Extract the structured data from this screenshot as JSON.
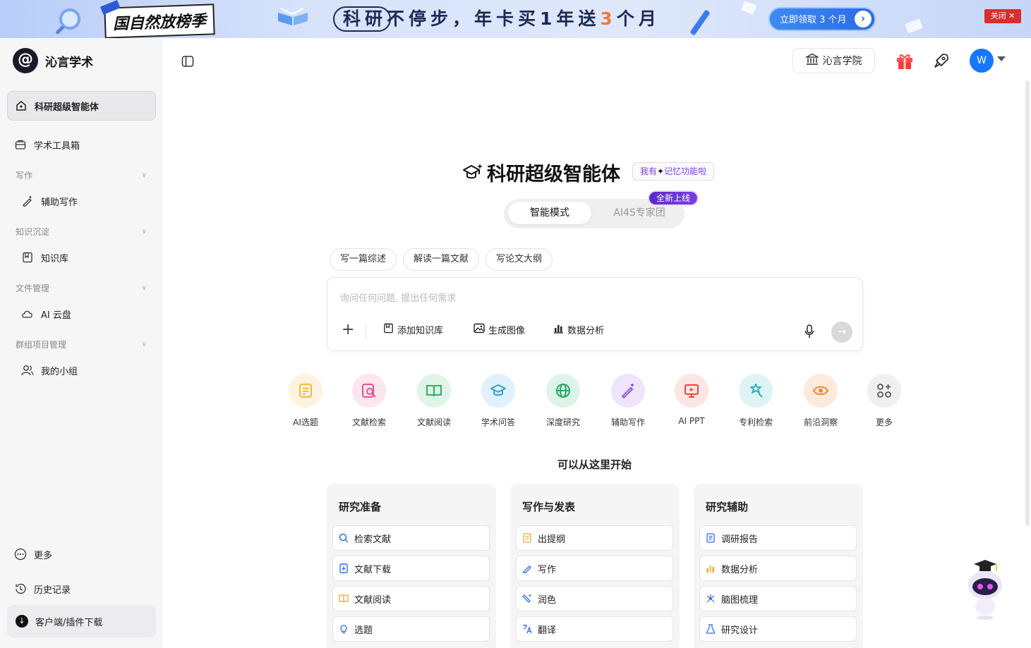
{
  "banner": {
    "tag": "国自然放榜季",
    "slogan_a": "科研不停步，",
    "slogan_b": "年卡买1年送",
    "slogan_num": "3",
    "slogan_c": "个月",
    "cta": "立即领取 3 个月",
    "close": "关闭"
  },
  "sidebar": {
    "brand": "沁言学术",
    "active": "科研超级智能体",
    "toolbox": "学术工具箱",
    "sections": [
      {
        "title": "写作",
        "item": "辅助写作"
      },
      {
        "title": "知识沉淀",
        "item": "知识库"
      },
      {
        "title": "文件管理",
        "item": "AI 云盘"
      },
      {
        "title": "群组项目管理",
        "item": "我的小组"
      }
    ],
    "more": "更多",
    "history": "历史记录",
    "download": "客户端/插件下载"
  },
  "topbar": {
    "academy": "沁言学院",
    "avatar": "W"
  },
  "hero": {
    "title": "科研超级智能体",
    "memory_a": "我有",
    "memory_b": "记忆功能啦",
    "new_badge": "全新上线",
    "mode_active": "智能模式",
    "mode_other": "AI4S专家团"
  },
  "chips": [
    "写一篇综述",
    "解读一篇文献",
    "写论文大纲"
  ],
  "composer": {
    "placeholder": "询问任何问题, 提出任何需求",
    "tools": [
      "添加知识库",
      "生成图像",
      "数据分析"
    ]
  },
  "tools": [
    {
      "label": "AI选题",
      "icon": "topic-icon",
      "color": "#f5b942",
      "bg": "#fdf3df"
    },
    {
      "label": "文献检索",
      "icon": "literature-search-icon",
      "color": "#ec4f8a",
      "bg": "#fde6ee"
    },
    {
      "label": "文献阅读",
      "icon": "book-open-icon",
      "color": "#2fae6a",
      "bg": "#e0f5e8"
    },
    {
      "label": "学术问答",
      "icon": "graduation-cap-icon",
      "color": "#2f9ed8",
      "bg": "#e0f1fb"
    },
    {
      "label": "深度研究",
      "icon": "globe-icon",
      "color": "#26a66a",
      "bg": "#dff4e8"
    },
    {
      "label": "辅助写作",
      "icon": "magic-pen-icon",
      "color": "#8d5be6",
      "bg": "#eee5fc"
    },
    {
      "label": "AI PPT",
      "icon": "presentation-icon",
      "color": "#e3483f",
      "bg": "#fde5e3"
    },
    {
      "label": "专利检索",
      "icon": "patent-search-icon",
      "color": "#2cb3b8",
      "bg": "#def4f4"
    },
    {
      "label": "前沿洞察",
      "icon": "eye-icon",
      "color": "#f0883a",
      "bg": "#fdeadb"
    },
    {
      "label": "更多",
      "icon": "more-grid-icon",
      "color": "#555",
      "bg": "#f0f0f2"
    }
  ],
  "start_title": "可以从这里开始",
  "cards": [
    {
      "title": "研究准备",
      "items": [
        {
          "label": "检索文献",
          "icon": "search-icon",
          "color": "#2f6ee6"
        },
        {
          "label": "文献下载",
          "icon": "download-doc-icon",
          "color": "#2f6ee6"
        },
        {
          "label": "文献阅读",
          "icon": "book-open-icon",
          "color": "#f0a63a"
        },
        {
          "label": "选题",
          "icon": "bulb-icon",
          "color": "#2f6ee6"
        }
      ]
    },
    {
      "title": "写作与发表",
      "items": [
        {
          "label": "出提纲",
          "icon": "outline-icon",
          "color": "#f0a63a"
        },
        {
          "label": "写作",
          "icon": "pen-icon",
          "color": "#2f6ee6"
        },
        {
          "label": "润色",
          "icon": "polish-icon",
          "color": "#2f6ee6"
        },
        {
          "label": "翻译",
          "icon": "translate-icon",
          "color": "#2f6ee6"
        }
      ]
    },
    {
      "title": "研究辅助",
      "items": [
        {
          "label": "调研报告",
          "icon": "report-icon",
          "color": "#2f6ee6"
        },
        {
          "label": "数据分析",
          "icon": "bar-chart-icon",
          "color": "#f0a63a"
        },
        {
          "label": "脑图梳理",
          "icon": "mindmap-icon",
          "color": "#2f6ee6"
        },
        {
          "label": "研究设计",
          "icon": "flask-icon",
          "color": "#2f6ee6"
        }
      ]
    }
  ]
}
